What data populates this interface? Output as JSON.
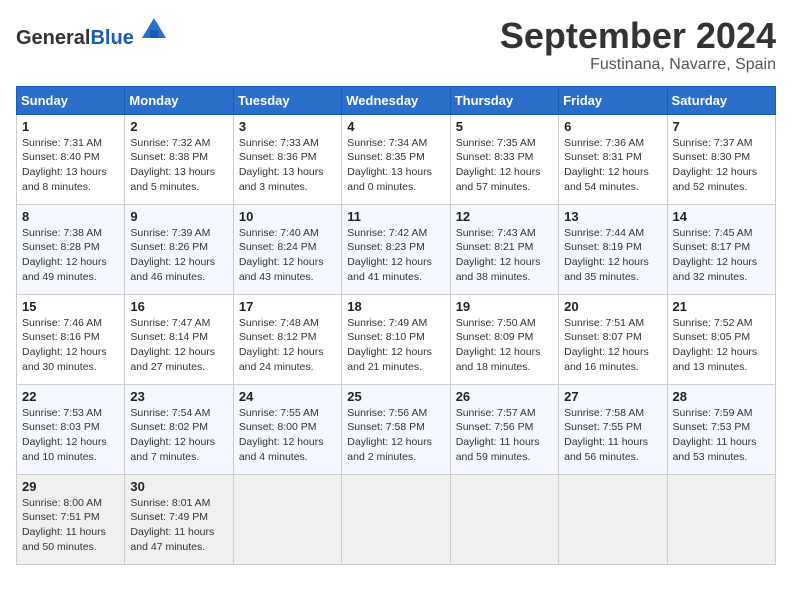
{
  "header": {
    "logo_general": "General",
    "logo_blue": "Blue",
    "month": "September 2024",
    "location": "Fustinana, Navarre, Spain"
  },
  "weekdays": [
    "Sunday",
    "Monday",
    "Tuesday",
    "Wednesday",
    "Thursday",
    "Friday",
    "Saturday"
  ],
  "weeks": [
    [
      {
        "day": "1",
        "text": "Sunrise: 7:31 AM\nSunset: 8:40 PM\nDaylight: 13 hours\nand 8 minutes."
      },
      {
        "day": "2",
        "text": "Sunrise: 7:32 AM\nSunset: 8:38 PM\nDaylight: 13 hours\nand 5 minutes."
      },
      {
        "day": "3",
        "text": "Sunrise: 7:33 AM\nSunset: 8:36 PM\nDaylight: 13 hours\nand 3 minutes."
      },
      {
        "day": "4",
        "text": "Sunrise: 7:34 AM\nSunset: 8:35 PM\nDaylight: 13 hours\nand 0 minutes."
      },
      {
        "day": "5",
        "text": "Sunrise: 7:35 AM\nSunset: 8:33 PM\nDaylight: 12 hours\nand 57 minutes."
      },
      {
        "day": "6",
        "text": "Sunrise: 7:36 AM\nSunset: 8:31 PM\nDaylight: 12 hours\nand 54 minutes."
      },
      {
        "day": "7",
        "text": "Sunrise: 7:37 AM\nSunset: 8:30 PM\nDaylight: 12 hours\nand 52 minutes."
      }
    ],
    [
      {
        "day": "8",
        "text": "Sunrise: 7:38 AM\nSunset: 8:28 PM\nDaylight: 12 hours\nand 49 minutes."
      },
      {
        "day": "9",
        "text": "Sunrise: 7:39 AM\nSunset: 8:26 PM\nDaylight: 12 hours\nand 46 minutes."
      },
      {
        "day": "10",
        "text": "Sunrise: 7:40 AM\nSunset: 8:24 PM\nDaylight: 12 hours\nand 43 minutes."
      },
      {
        "day": "11",
        "text": "Sunrise: 7:42 AM\nSunset: 8:23 PM\nDaylight: 12 hours\nand 41 minutes."
      },
      {
        "day": "12",
        "text": "Sunrise: 7:43 AM\nSunset: 8:21 PM\nDaylight: 12 hours\nand 38 minutes."
      },
      {
        "day": "13",
        "text": "Sunrise: 7:44 AM\nSunset: 8:19 PM\nDaylight: 12 hours\nand 35 minutes."
      },
      {
        "day": "14",
        "text": "Sunrise: 7:45 AM\nSunset: 8:17 PM\nDaylight: 12 hours\nand 32 minutes."
      }
    ],
    [
      {
        "day": "15",
        "text": "Sunrise: 7:46 AM\nSunset: 8:16 PM\nDaylight: 12 hours\nand 30 minutes."
      },
      {
        "day": "16",
        "text": "Sunrise: 7:47 AM\nSunset: 8:14 PM\nDaylight: 12 hours\nand 27 minutes."
      },
      {
        "day": "17",
        "text": "Sunrise: 7:48 AM\nSunset: 8:12 PM\nDaylight: 12 hours\nand 24 minutes."
      },
      {
        "day": "18",
        "text": "Sunrise: 7:49 AM\nSunset: 8:10 PM\nDaylight: 12 hours\nand 21 minutes."
      },
      {
        "day": "19",
        "text": "Sunrise: 7:50 AM\nSunset: 8:09 PM\nDaylight: 12 hours\nand 18 minutes."
      },
      {
        "day": "20",
        "text": "Sunrise: 7:51 AM\nSunset: 8:07 PM\nDaylight: 12 hours\nand 16 minutes."
      },
      {
        "day": "21",
        "text": "Sunrise: 7:52 AM\nSunset: 8:05 PM\nDaylight: 12 hours\nand 13 minutes."
      }
    ],
    [
      {
        "day": "22",
        "text": "Sunrise: 7:53 AM\nSunset: 8:03 PM\nDaylight: 12 hours\nand 10 minutes."
      },
      {
        "day": "23",
        "text": "Sunrise: 7:54 AM\nSunset: 8:02 PM\nDaylight: 12 hours\nand 7 minutes."
      },
      {
        "day": "24",
        "text": "Sunrise: 7:55 AM\nSunset: 8:00 PM\nDaylight: 12 hours\nand 4 minutes."
      },
      {
        "day": "25",
        "text": "Sunrise: 7:56 AM\nSunset: 7:58 PM\nDaylight: 12 hours\nand 2 minutes."
      },
      {
        "day": "26",
        "text": "Sunrise: 7:57 AM\nSunset: 7:56 PM\nDaylight: 11 hours\nand 59 minutes."
      },
      {
        "day": "27",
        "text": "Sunrise: 7:58 AM\nSunset: 7:55 PM\nDaylight: 11 hours\nand 56 minutes."
      },
      {
        "day": "28",
        "text": "Sunrise: 7:59 AM\nSunset: 7:53 PM\nDaylight: 11 hours\nand 53 minutes."
      }
    ],
    [
      {
        "day": "29",
        "text": "Sunrise: 8:00 AM\nSunset: 7:51 PM\nDaylight: 11 hours\nand 50 minutes."
      },
      {
        "day": "30",
        "text": "Sunrise: 8:01 AM\nSunset: 7:49 PM\nDaylight: 11 hours\nand 47 minutes."
      },
      {
        "day": "",
        "text": ""
      },
      {
        "day": "",
        "text": ""
      },
      {
        "day": "",
        "text": ""
      },
      {
        "day": "",
        "text": ""
      },
      {
        "day": "",
        "text": ""
      }
    ]
  ]
}
